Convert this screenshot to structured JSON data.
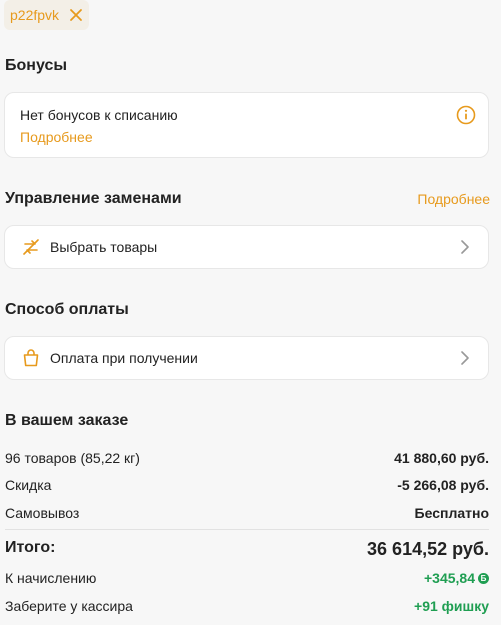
{
  "promo": {
    "code": "p22fpvk",
    "remove_icon": "close-icon"
  },
  "bonuses": {
    "title": "Бонусы",
    "card_text": "Нет бонусов к списанию",
    "link": "Подробнее",
    "icon": "info-icon"
  },
  "replacements": {
    "title": "Управление заменами",
    "link": "Подробнее",
    "item_label": "Выбрать товары",
    "icon": "swap-icon"
  },
  "payment": {
    "title": "Способ оплаты",
    "item_label": "Оплата при получении",
    "icon": "bag-icon"
  },
  "order": {
    "title": "В вашем заказе",
    "rows": [
      {
        "label": "96 товаров (85,22 кг)",
        "value": "41 880,60 руб."
      },
      {
        "label": "Скидка",
        "value": "-5 266,08 руб."
      },
      {
        "label": "Самовывоз",
        "value": "Бесплатно"
      }
    ],
    "total_label": "Итого:",
    "total_value": "36 614,52 руб.",
    "accrual_label": "К начислению",
    "accrual_value": "+345,84",
    "cashier_label": "Заберите у кассира",
    "cashier_value": "+91 фишку"
  },
  "colors": {
    "accent": "#e79a1d",
    "green": "#1f9e52"
  }
}
